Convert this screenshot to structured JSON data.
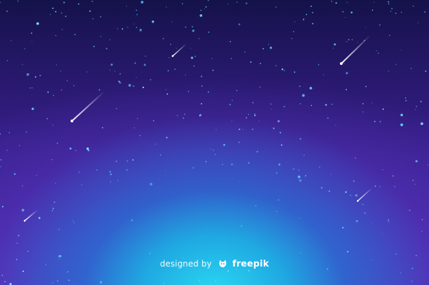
{
  "image": {
    "description_colors": {
      "sky_top": "#15124a",
      "sky_mid": "#3a1f8f",
      "horizon_glow": "#2ad8f2",
      "star": "#7fe9ff",
      "meteor": "#ffffff"
    }
  },
  "credit": {
    "designed_by": "designed by",
    "brand": "freepik",
    "logo_icon": "freepik-logo-icon"
  }
}
